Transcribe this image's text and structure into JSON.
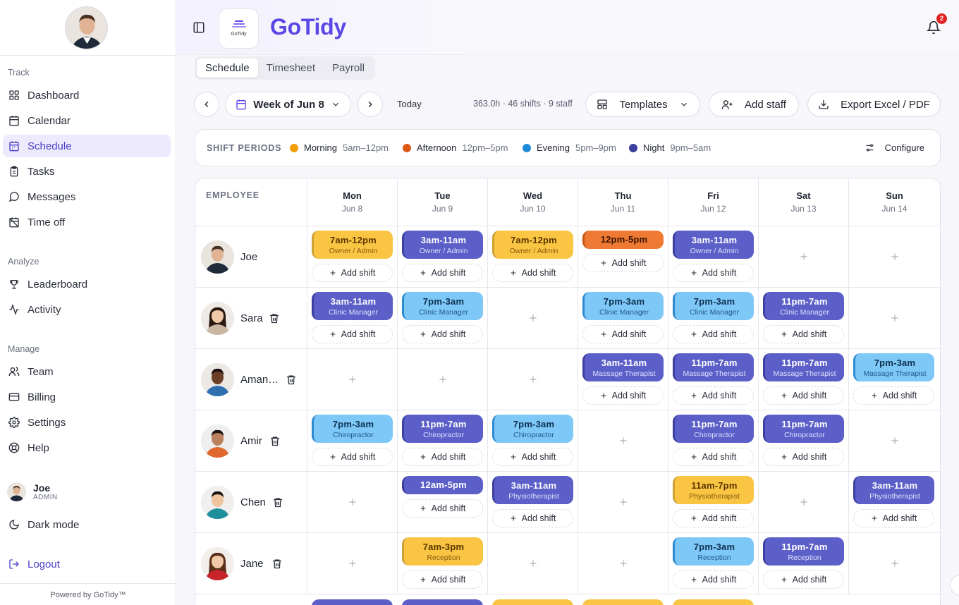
{
  "sidebar": {
    "sections": [
      "Track",
      "Analyze",
      "Manage"
    ],
    "items": [
      {
        "label": "Dashboard",
        "icon": "dashboard-icon"
      },
      {
        "label": "Calendar",
        "icon": "calendar-icon"
      },
      {
        "label": "Schedule",
        "icon": "schedule-icon",
        "active": true
      },
      {
        "label": "Tasks",
        "icon": "clipboard-icon"
      },
      {
        "label": "Messages",
        "icon": "chat-icon"
      },
      {
        "label": "Time off",
        "icon": "calendar-off-icon"
      },
      {
        "label": "Leaderboard",
        "icon": "trophy-icon"
      },
      {
        "label": "Activity",
        "icon": "activity-icon"
      },
      {
        "label": "Team",
        "icon": "users-icon"
      },
      {
        "label": "Billing",
        "icon": "card-icon"
      },
      {
        "label": "Settings",
        "icon": "gear-icon"
      },
      {
        "label": "Help",
        "icon": "lifebuoy-icon"
      }
    ],
    "user": {
      "name": "Joe",
      "role": "ADMIN"
    },
    "dark_mode": "Dark mode",
    "logout": "Logout",
    "powered": "Powered by GoTidy™"
  },
  "header": {
    "brand": "GoTidy",
    "logo_text": "GoTidy",
    "notifications": "2"
  },
  "tabs": [
    "Schedule",
    "Timesheet",
    "Payroll"
  ],
  "toolbar": {
    "week": "Week of Jun 8",
    "today": "Today",
    "summary": "363.0h · 46 shifts · 9 staff",
    "templates": "Templates",
    "add_staff": "Add staff",
    "export": "Export Excel / PDF"
  },
  "periods": {
    "title": "SHIFT PERIODS",
    "items": [
      {
        "name": "Morning",
        "time": "5am–12pm",
        "color": "#f59e0b"
      },
      {
        "name": "Afternoon",
        "time": "12pm–5pm",
        "color": "#dd5a16"
      },
      {
        "name": "Evening",
        "time": "5pm–9pm",
        "color": "#1f8bd6"
      },
      {
        "name": "Night",
        "time": "9pm–5am",
        "color": "#3b3f9e"
      }
    ],
    "configure": "Configure"
  },
  "grid": {
    "employee_header": "EMPLOYEE",
    "add_shift": "Add shift",
    "days": [
      {
        "name": "Mon",
        "date": "Jun 8"
      },
      {
        "name": "Tue",
        "date": "Jun 9"
      },
      {
        "name": "Wed",
        "date": "Jun 10"
      },
      {
        "name": "Thu",
        "date": "Jun 11"
      },
      {
        "name": "Fri",
        "date": "Jun 12"
      },
      {
        "name": "Sat",
        "date": "Jun 13"
      },
      {
        "name": "Sun",
        "date": "Jun 14"
      }
    ],
    "rows": [
      {
        "name": "Joe",
        "deletable": false,
        "shifts": [
          {
            "time": "7am-12pm",
            "role": "Owner / Admin",
            "period": "mor"
          },
          {
            "time": "3am-11am",
            "role": "Owner / Admin",
            "period": "nig"
          },
          {
            "time": "7am-12pm",
            "role": "Owner / Admin",
            "period": "mor"
          },
          {
            "time": "12pm-5pm",
            "role": "",
            "period": "aft"
          },
          {
            "time": "3am-11am",
            "role": "Owner / Admin",
            "period": "nig"
          },
          null,
          null
        ]
      },
      {
        "name": "Sara",
        "deletable": true,
        "shifts": [
          {
            "time": "3am-11am",
            "role": "Clinic Manager",
            "period": "nig"
          },
          {
            "time": "7pm-3am",
            "role": "Clinic Manager",
            "period": "eve"
          },
          null,
          {
            "time": "7pm-3am",
            "role": "Clinic Manager",
            "period": "eve"
          },
          {
            "time": "7pm-3am",
            "role": "Clinic Manager",
            "period": "eve"
          },
          {
            "time": "11pm-7am",
            "role": "Clinic Manager",
            "period": "nig"
          },
          null
        ]
      },
      {
        "name": "Aman…",
        "deletable": true,
        "shifts": [
          null,
          null,
          null,
          {
            "time": "3am-11am",
            "role": "Massage Therapist",
            "period": "nig"
          },
          {
            "time": "11pm-7am",
            "role": "Massage Therapist",
            "period": "nig"
          },
          {
            "time": "11pm-7am",
            "role": "Massage Therapist",
            "period": "nig"
          },
          {
            "time": "7pm-3am",
            "role": "Massage Therapist",
            "period": "eve"
          }
        ]
      },
      {
        "name": "Amir",
        "deletable": true,
        "shifts": [
          {
            "time": "7pm-3am",
            "role": "Chiropractor",
            "period": "eve"
          },
          {
            "time": "11pm-7am",
            "role": "Chiropractor",
            "period": "nig"
          },
          {
            "time": "7pm-3am",
            "role": "Chiropractor",
            "period": "eve"
          },
          null,
          {
            "time": "11pm-7am",
            "role": "Chiropractor",
            "period": "nig"
          },
          {
            "time": "11pm-7am",
            "role": "Chiropractor",
            "period": "nig"
          },
          null
        ]
      },
      {
        "name": "Chen",
        "deletable": true,
        "shifts": [
          null,
          {
            "time": "12am-5pm",
            "role": "",
            "period": "nig"
          },
          {
            "time": "3am-11am",
            "role": "Physiotherapist",
            "period": "nig"
          },
          null,
          {
            "time": "11am-7pm",
            "role": "Physiotherapist",
            "period": "mor"
          },
          null,
          {
            "time": "3am-11am",
            "role": "Physiotherapist",
            "period": "nig"
          }
        ]
      },
      {
        "name": "Jane",
        "deletable": true,
        "shifts": [
          null,
          {
            "time": "7am-3pm",
            "role": "Reception",
            "period": "mor"
          },
          null,
          null,
          {
            "time": "7pm-3am",
            "role": "Reception",
            "period": "eve"
          },
          {
            "time": "11pm-7am",
            "role": "Reception",
            "period": "nig"
          },
          null
        ]
      }
    ],
    "peek_periods": [
      "nig",
      "nig",
      "mor",
      "mor",
      "mor",
      null,
      null
    ]
  }
}
